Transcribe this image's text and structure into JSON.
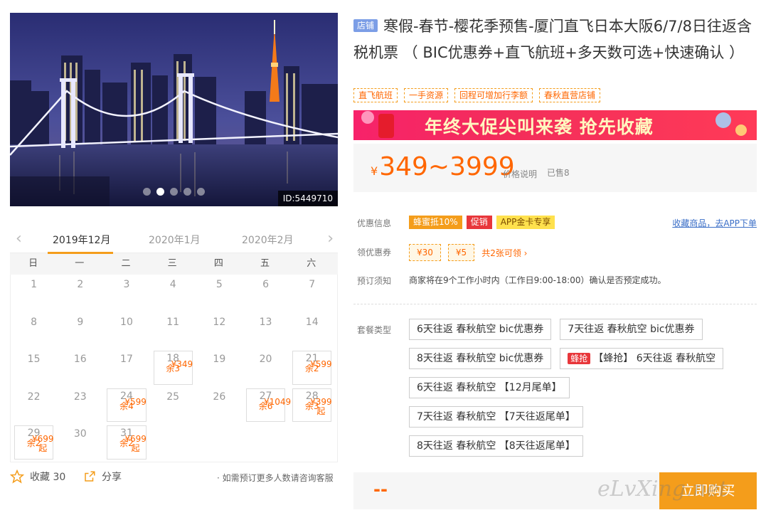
{
  "hero": {
    "id_label": "ID:5449710",
    "active_slide": 2,
    "slide_count": 5
  },
  "calendar": {
    "months": [
      "2019年12月",
      "2020年1月",
      "2020年2月"
    ],
    "weekdays": [
      "日",
      "一",
      "二",
      "三",
      "四",
      "五",
      "六"
    ],
    "days": [
      {
        "d": "1"
      },
      {
        "d": "2"
      },
      {
        "d": "3"
      },
      {
        "d": "4"
      },
      {
        "d": "5"
      },
      {
        "d": "6"
      },
      {
        "d": "7"
      },
      {
        "d": "8"
      },
      {
        "d": "9"
      },
      {
        "d": "10"
      },
      {
        "d": "11"
      },
      {
        "d": "12"
      },
      {
        "d": "13"
      },
      {
        "d": "14"
      },
      {
        "d": "15"
      },
      {
        "d": "16"
      },
      {
        "d": "17"
      },
      {
        "d": "18",
        "price": "¥349",
        "stock": "余3"
      },
      {
        "d": "19"
      },
      {
        "d": "20"
      },
      {
        "d": "21",
        "price": "¥599",
        "stock": "余2"
      },
      {
        "d": "22"
      },
      {
        "d": "23"
      },
      {
        "d": "24",
        "price": "¥599",
        "stock": "余4"
      },
      {
        "d": "25"
      },
      {
        "d": "26"
      },
      {
        "d": "27",
        "price": "¥1049",
        "stock": "余6"
      },
      {
        "d": "28",
        "price": "¥399起",
        "stock": "余3"
      },
      {
        "d": "29",
        "price": "¥699起",
        "stock": "余2"
      },
      {
        "d": "30"
      },
      {
        "d": "31",
        "price": "¥699起",
        "stock": "余2"
      }
    ]
  },
  "actions": {
    "favorite": "收藏 30",
    "share": "分享",
    "note": "· 如需预订更多人数请咨询客服"
  },
  "product": {
    "shop_badge": "店铺",
    "title": "寒假-春节-樱花季预售-厦门直飞日本大阪6/7/8日往返含税机票 （ BIC优惠券+直飞航班+多天数可选+快速确认 ）",
    "tags": [
      "直飞航班",
      "一手资源",
      "回程可增加行李额",
      "春秋直营店铺"
    ],
    "banner": "年终大促尖叫来袭  抢先收藏",
    "price_yen": "¥",
    "price": "349~3999",
    "price_note": "价格说明",
    "sold": "已售8"
  },
  "offers": {
    "label": "优惠信息",
    "badges": [
      "蜂蜜抵10%",
      "促销",
      "APP金卡专享"
    ],
    "app_link": "收藏商品，去APP下单"
  },
  "coupons": {
    "label": "领优惠券",
    "items": [
      "¥30",
      "¥5"
    ],
    "more": "共2张可领 ›"
  },
  "booking": {
    "label": "预订须知",
    "text": "商家将在9个工作小时内（工作日9:00-18:00）确认是否预定成功。"
  },
  "packages": {
    "label": "套餐类型",
    "hot_badge": "蜂抢",
    "items": [
      "6天往返 春秋航空 bic优惠券",
      "7天往返 春秋航空 bic优惠券",
      "8天往返 春秋航空 bic优惠券",
      "【蜂抢】 6天往返 春秋航空",
      "6天往返 春秋航空 【12月尾单】",
      "7天往返 春秋航空 【7天往返尾单】",
      "8天往返 春秋航空 【8天往返尾单】"
    ]
  },
  "buy": {
    "price_placeholder": "--",
    "button": "立即购买"
  },
  "watermark": "eLvXing.net",
  "colors": {
    "accent": "#f49d1b",
    "price": "#ff6600",
    "promo_red": "#e8373b",
    "link": "#3a6ec7"
  }
}
